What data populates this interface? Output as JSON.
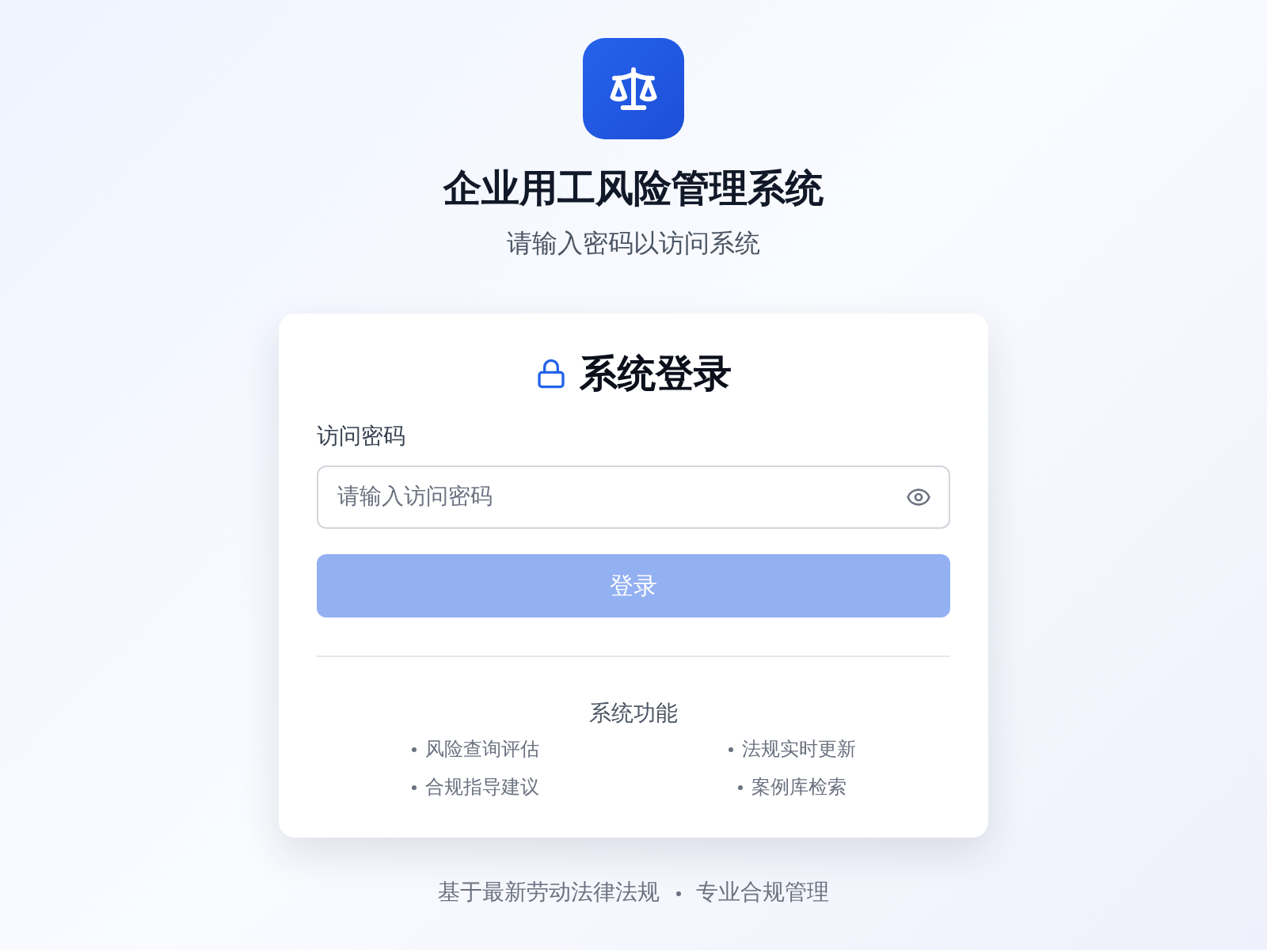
{
  "header": {
    "title": "企业用工风险管理系统",
    "subtitle": "请输入密码以访问系统"
  },
  "login": {
    "title": "系统登录",
    "field": {
      "label": "访问密码",
      "placeholder": "请输入访问密码"
    },
    "button": {
      "label": "登录",
      "disabled": true
    }
  },
  "features": {
    "title": "系统功能",
    "items": [
      "风险查询评估",
      "法规实时更新",
      "合规指导建议",
      "案例库检索"
    ]
  },
  "footer": {
    "parts": [
      "基于最新劳动法律法规",
      "专业合规管理"
    ]
  }
}
